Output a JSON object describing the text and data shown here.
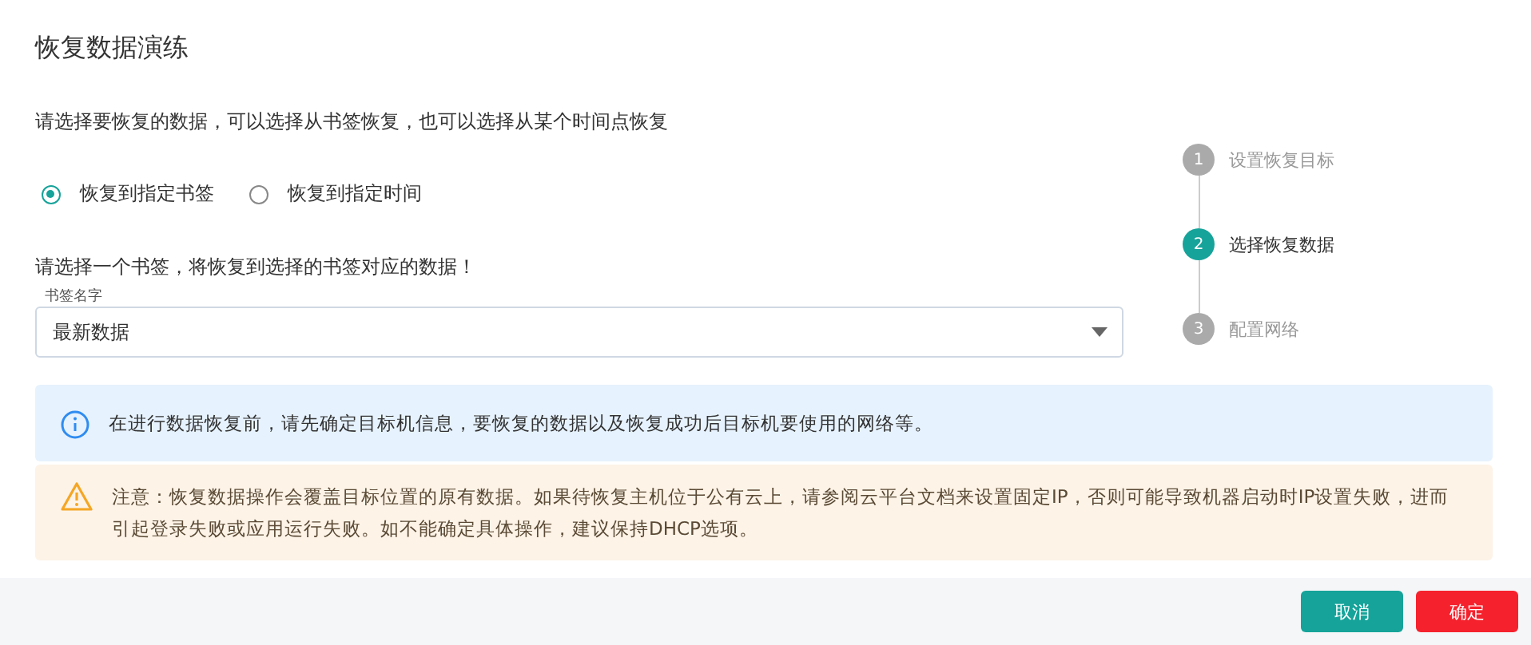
{
  "dialog": {
    "title": "恢复数据演练"
  },
  "description": "请选择要恢复的数据，可以选择从书签恢复，也可以选择从某个时间点恢复",
  "restore_options": [
    {
      "label": "恢复到指定书签",
      "selected": true
    },
    {
      "label": "恢复到指定时间",
      "selected": false
    }
  ],
  "bookmark_hint": "请选择一个书签，将恢复到选择的书签对应的数据！",
  "bookmark_select": {
    "label": "书签名字",
    "value": "最新数据"
  },
  "steps": [
    {
      "number": "1",
      "label": "设置恢复目标",
      "selected": false
    },
    {
      "number": "2",
      "label": "选择恢复数据",
      "selected": true
    },
    {
      "number": "3",
      "label": "配置网络",
      "selected": false
    }
  ],
  "alerts": [
    {
      "kind": "info",
      "text": "在进行数据恢复前，请先确定目标机信息，要恢复的数据以及恢复成功后目标机要使用的网络等。"
    },
    {
      "kind": "warning",
      "text": "注意：恢复数据操作会覆盖目标位置的原有数据。如果待恢复主机位于公有云上，请参阅云平台文档来设置固定IP，否则可能导致机器启动时IP设置失败，进而引起登录失败或应用运行失败。如不能确定具体操作，建议保持DHCP选项。"
    }
  ],
  "buttons": [
    {
      "label": "取消",
      "kind": "secondary"
    },
    {
      "label": "确定",
      "kind": "primary"
    }
  ]
}
